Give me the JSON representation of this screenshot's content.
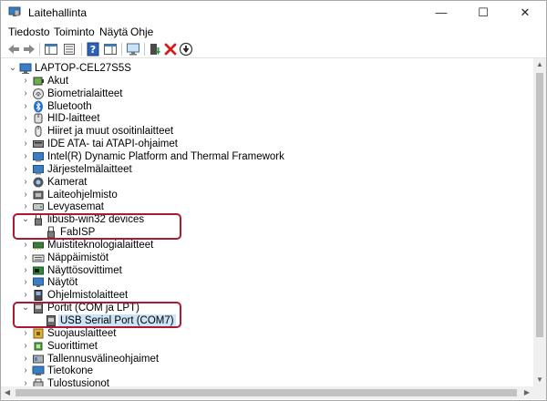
{
  "window": {
    "title": "Laitehallinta",
    "minimize": "—",
    "maximize": "☐",
    "close": "✕"
  },
  "menu": [
    "Tiedosto",
    "Toiminto",
    "Näytä",
    "Ohje"
  ],
  "toolbar": [
    "back-arrow-icon",
    "forward-arrow-icon",
    "show-hide-console-tree-icon",
    "properties-icon",
    "help-icon",
    "action-pane-icon",
    "scan-hardware-icon",
    "update-driver-icon",
    "uninstall-device-icon",
    "disable-device-icon"
  ],
  "tree": {
    "root": "LAPTOP-CEL27S5S",
    "items": [
      {
        "label": "Akut",
        "icon": "battery-icon",
        "expanded": false
      },
      {
        "label": "Biometrialaitteet",
        "icon": "fingerprint-icon",
        "expanded": false
      },
      {
        "label": "Bluetooth",
        "icon": "bluetooth-icon",
        "expanded": false
      },
      {
        "label": "HID-laitteet",
        "icon": "hid-device-icon",
        "expanded": false
      },
      {
        "label": "Hiiret ja muut osoitinlaitteet",
        "icon": "mouse-icon",
        "expanded": false
      },
      {
        "label": "IDE ATA- tai ATAPI-ohjaimet",
        "icon": "ide-controller-icon",
        "expanded": false
      },
      {
        "label": "Intel(R) Dynamic Platform and Thermal Framework",
        "icon": "system-device-icon",
        "expanded": false
      },
      {
        "label": "Järjestelmälaitteet",
        "icon": "system-device-icon",
        "expanded": false
      },
      {
        "label": "Kamerat",
        "icon": "camera-icon",
        "expanded": false
      },
      {
        "label": "Laiteohjelmisto",
        "icon": "firmware-icon",
        "expanded": false
      },
      {
        "label": "Levyasemat",
        "icon": "disk-drive-icon",
        "expanded": false
      },
      {
        "label": "libusb-win32 devices",
        "icon": "usb-device-icon",
        "expanded": true,
        "highlight": true,
        "children": [
          {
            "label": "FabISP",
            "icon": "usb-device-icon"
          }
        ]
      },
      {
        "label": "Muistiteknologialaitteet",
        "icon": "memory-technology-icon",
        "expanded": false
      },
      {
        "label": "Näppäimistöt",
        "icon": "keyboard-icon",
        "expanded": false
      },
      {
        "label": "Näyttösovittimet",
        "icon": "display-adapter-icon",
        "expanded": false
      },
      {
        "label": "Näytöt",
        "icon": "monitor-icon",
        "expanded": false
      },
      {
        "label": "Ohjelmistolaitteet",
        "icon": "software-device-icon",
        "expanded": false
      },
      {
        "label": "Portit (COM ja LPT)",
        "icon": "port-icon",
        "expanded": true,
        "highlight": true,
        "children": [
          {
            "label": "USB Serial Port (COM7)",
            "icon": "port-icon",
            "selected": true
          }
        ]
      },
      {
        "label": "Suojauslaitteet",
        "icon": "security-device-icon",
        "expanded": false
      },
      {
        "label": "Suorittimet",
        "icon": "processor-icon",
        "expanded": false
      },
      {
        "label": "Tallennusvälineohjaimet",
        "icon": "storage-controller-icon",
        "expanded": false
      },
      {
        "label": "Tietokone",
        "icon": "computer-icon",
        "expanded": false
      },
      {
        "label": "Tulostusjonot",
        "icon": "print-queue-icon",
        "expanded": false
      }
    ]
  },
  "colors": {
    "highlight_border": "#b01832",
    "selection": "#cce4f7"
  }
}
